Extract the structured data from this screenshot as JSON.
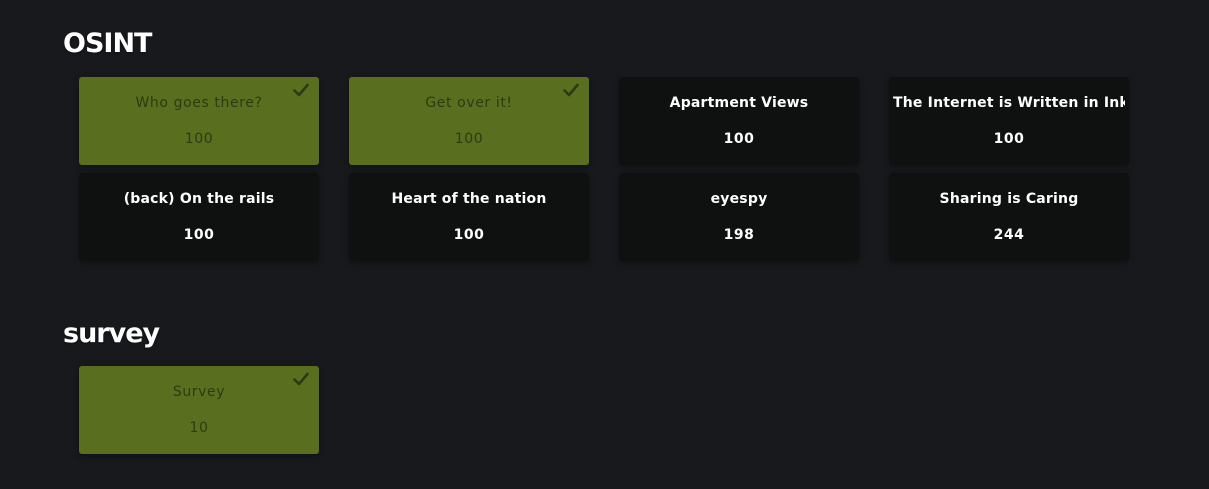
{
  "categories": [
    {
      "title": "OSINT",
      "challenges": [
        {
          "name": "Who goes there?",
          "value": "100",
          "solved": true
        },
        {
          "name": "Get over it!",
          "value": "100",
          "solved": true
        },
        {
          "name": "Apartment Views",
          "value": "100",
          "solved": false
        },
        {
          "name": "The Internet is Written in Ink",
          "value": "100",
          "solved": false
        },
        {
          "name": "(back) On the rails",
          "value": "100",
          "solved": false
        },
        {
          "name": "Heart of the nation",
          "value": "100",
          "solved": false
        },
        {
          "name": "eyespy",
          "value": "198",
          "solved": false
        },
        {
          "name": "Sharing is Caring",
          "value": "244",
          "solved": false
        }
      ]
    },
    {
      "title": "survey",
      "challenges": [
        {
          "name": "Survey",
          "value": "10",
          "solved": true
        }
      ]
    }
  ],
  "icons": {
    "solved": "check-icon"
  },
  "colors": {
    "background": "#18191d",
    "card": "#0f1110",
    "solved_card": "#5a6e1f",
    "solved_text": "#2f3a12",
    "text": "#ffffff"
  }
}
